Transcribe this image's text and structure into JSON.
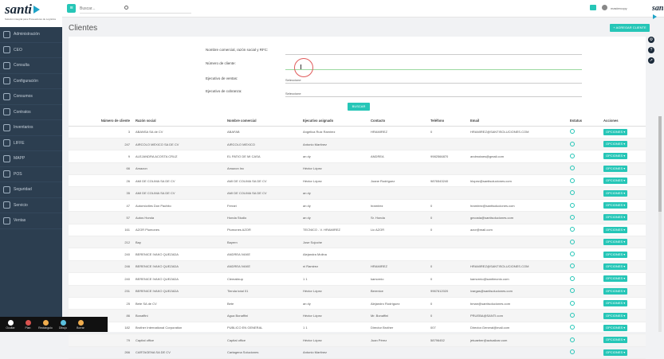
{
  "sidebar": {
    "brand": "santi",
    "tagline": "Solución integral para Proveedores de Logística",
    "items": [
      {
        "label": "Administración"
      },
      {
        "label": "CEO"
      },
      {
        "label": "Consulta"
      },
      {
        "label": "Configuración"
      },
      {
        "label": "Consumos"
      },
      {
        "label": "Contratos"
      },
      {
        "label": "Inventarios"
      },
      {
        "label": "LIFFE"
      },
      {
        "label": "MAPP"
      },
      {
        "label": "POS"
      },
      {
        "label": "Seguridad"
      },
      {
        "label": "Servicio"
      },
      {
        "label": "Ventas"
      }
    ]
  },
  "topbar": {
    "search_placeholder": "Buscar...",
    "username": "mastercopy",
    "brand": "santi"
  },
  "page": {
    "title": "Clientes",
    "add_button": "+ AGREGAR CLIENTE"
  },
  "filters": {
    "label_name": "Nombre comercial, razón social y RFC:",
    "label_number": "Número de cliente:",
    "label_sales": "Ejecutivo de ventas:",
    "value_sales": "Seleccione",
    "label_collections": "Ejecutivo de cobranza:",
    "value_collections": "Seleccione",
    "search_button": "BUSCAR"
  },
  "table": {
    "headers": [
      "Número de cliente",
      "Razón social",
      "Nombre comercial",
      "Ejecutivo asignado",
      "Contacto",
      "Teléfono",
      "Email",
      "Estatus",
      "Acciones"
    ],
    "options_label": "OPCIONES ▾",
    "rows": [
      [
        "3",
        "ABANSA SA de CV",
        "ABAFAB",
        "Angelica Ruiz Ramirez",
        "HRAMIREZ",
        "0",
        "HRAMIREZ@SANTISOLUCIONES.COM"
      ],
      [
        "247",
        "AIRCOLO MEXICO SA DE CV",
        "AIRCOLO MEXICO",
        "Antonio Martinez",
        "",
        "",
        ""
      ],
      [
        "9",
        "ALEJANDRA ACOSTA CRUZ",
        "EL PATIO DE MI CASA",
        "an dy",
        "ANDREA",
        "9982566870",
        "andmotaes@gmail.com"
      ],
      [
        "66",
        "Amazon",
        "Amazon Inc",
        "Héctor López",
        "",
        "",
        ""
      ],
      [
        "26",
        "AMI DE COLIMA SA DE CV",
        "AMI DE COLIMA SA DE CV",
        "Héctor López",
        "Joane Rodriguez",
        "9876543240",
        "hlopez@santisoluciones.com"
      ],
      [
        "35",
        "AMI DE COLIMA SA DE CV",
        "AMI DE COLIMA SA DE CV",
        "an dy",
        "",
        "",
        ""
      ],
      [
        "47",
        "Automóviles Don Pachito",
        "Ferrari",
        "an dy",
        "hramirez",
        "0",
        "hramirez@santisoluciones.com"
      ],
      [
        "57",
        "Autos Honda",
        "Honda Studio",
        "an dy",
        "Sr. Honda",
        "0",
        "gecosta@santisoluciones.com"
      ],
      [
        "161",
        "AZOR Plumones",
        "Plumones AZOR",
        "TECNICO - V. HRAMIREZ",
        "Lic AZOR",
        "0",
        "azor@mail.com"
      ],
      [
        "212",
        "Bay",
        "Bayern",
        "Jose Sojoche",
        "",
        "",
        ""
      ],
      [
        "240",
        "BERENICE IVAKO QUEZADA",
        "ANDREA IVAKE",
        "Alejandra Molina",
        "",
        "",
        ""
      ],
      [
        "246",
        "BERENICE IVAKO QUEZADA",
        "ANDREA IVAKE",
        "ni Ramirez",
        "HRAMIREZ",
        "0",
        "HRAMIREZ@SANTISOLUCIONES.COM"
      ],
      [
        "240",
        "BERENICE IVAKO QUEZADA",
        "Clematixup",
        "1 1",
        "kamornio",
        "0",
        "kamornio@santimonio.com"
      ],
      [
        "231",
        "BERENICE IVAKO QUEZADA",
        "Tienda total 01",
        "Héctor López",
        "Berenice",
        "9967612020",
        "ivargas@santisoluciones.com"
      ],
      [
        "25",
        "Bete SA de CV",
        "Bete",
        "an dy",
        "Alejandro Rodríguez",
        "0",
        "bman@santisoluciones.com"
      ],
      [
        "86",
        "Bonaffini",
        "Agua Bonaffini",
        "Héctor López",
        "Mr. Bonaffini",
        "0",
        "PRUEBA@SANTI.com"
      ],
      [
        "182",
        "Brother International Corporation",
        "PUBLICO EN GENERAL",
        "1 1",
        "Director Brother",
        "007",
        "Director.General@mail.com"
      ],
      [
        "79",
        "Capital office",
        "Capital office",
        "Héctor López",
        "Juan Pérez",
        "58796452",
        "jetuaeber@actualizar.com"
      ],
      [
        "266",
        "CARTAGENA SA DE CV",
        "Cartagena Soluciones",
        "Antonio Martinez",
        "",
        "",
        ""
      ]
    ]
  },
  "recorder": {
    "items": [
      {
        "label": "Ocultar",
        "color": "#ffffff"
      },
      {
        "label": "Plan",
        "color": "#d9534f"
      },
      {
        "label": "Rectángulo",
        "color": "#f0ad4e"
      },
      {
        "label": "Dibujo",
        "color": "#5bc0de"
      },
      {
        "label": "Borrar",
        "color": "#f0ad4e"
      }
    ]
  },
  "colors": {
    "accent": "#26c6b7",
    "sidebar": "#2c3e50"
  }
}
